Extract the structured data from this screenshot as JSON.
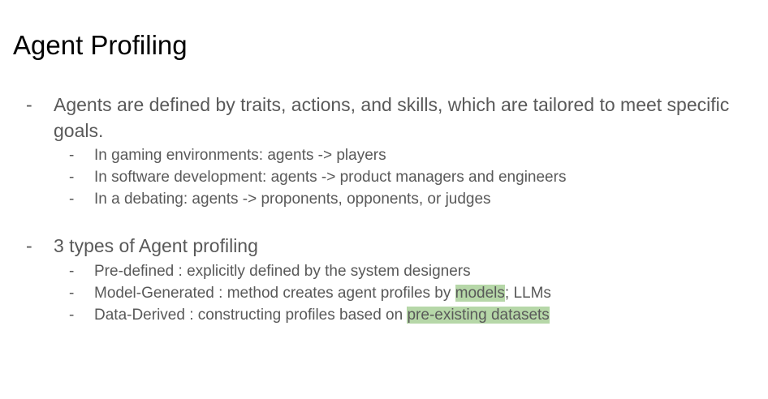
{
  "slide": {
    "title": "Agent Profiling",
    "bullets": [
      {
        "dash": "-",
        "text": "Agents are defined by traits, actions, and skills, which are tailored to meet specific goals.",
        "sub": [
          {
            "dash": "-",
            "text": "In gaming environments:  agents -> players"
          },
          {
            "dash": "-",
            "text": "In software development:  agents -> product managers and engineers"
          },
          {
            "dash": "-",
            "text": "In a debating: agents ->  proponents, opponents, or judges"
          }
        ]
      },
      {
        "dash": "-",
        "text": "3 types of Agent profiling",
        "sub": [
          {
            "dash": "-",
            "text": "Pre-defined : explicitly defined by the system designers"
          },
          {
            "dash": "-",
            "pre": "Model-Generated : method creates agent profiles by ",
            "highlight": "models",
            "post": "; LLMs"
          },
          {
            "dash": "-",
            "pre": "Data-Derived : constructing profiles based on ",
            "highlight": "pre-existing datasets",
            "post": ""
          }
        ]
      }
    ],
    "colors": {
      "title": "#000000",
      "body_text": "#595959",
      "highlight": "#b6d7a8"
    }
  }
}
